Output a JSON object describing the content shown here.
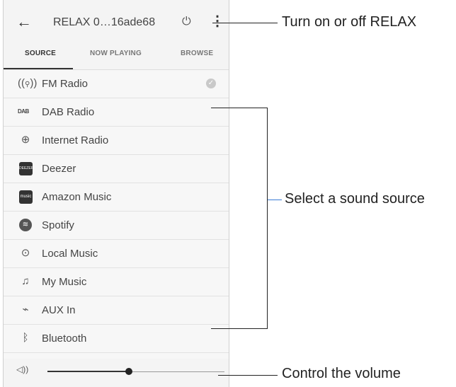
{
  "header": {
    "back_icon": "back-arrow-icon",
    "title": "RELAX 0…16ade68",
    "power_icon": "power-icon",
    "menu_icon": "more-vert-icon"
  },
  "tabs": [
    {
      "label": "SOURCE",
      "active": true
    },
    {
      "label": "NOW PLAYING",
      "active": false
    },
    {
      "label": "BROWSE",
      "active": false
    }
  ],
  "sources": [
    {
      "label": "FM Radio",
      "icon": "fm-radio-icon",
      "selected": true
    },
    {
      "label": "DAB Radio",
      "icon": "dab-icon",
      "icon_text": "DAB"
    },
    {
      "label": "Internet Radio",
      "icon": "internet-radio-icon"
    },
    {
      "label": "Deezer",
      "icon": "deezer-icon",
      "icon_text": "DEEZER"
    },
    {
      "label": "Amazon Music",
      "icon": "amazon-music-icon",
      "icon_text": "music"
    },
    {
      "label": "Spotify",
      "icon": "spotify-icon"
    },
    {
      "label": "Local Music",
      "icon": "local-music-icon"
    },
    {
      "label": "My Music",
      "icon": "music-note-icon"
    },
    {
      "label": "AUX In",
      "icon": "aux-icon"
    },
    {
      "label": "Bluetooth",
      "icon": "bluetooth-icon"
    }
  ],
  "volume": {
    "icon": "speaker-icon",
    "level": 0.46
  },
  "annotations": {
    "power": "Turn on or off RELAX",
    "source": "Select a sound source",
    "volume": "Control the volume"
  }
}
